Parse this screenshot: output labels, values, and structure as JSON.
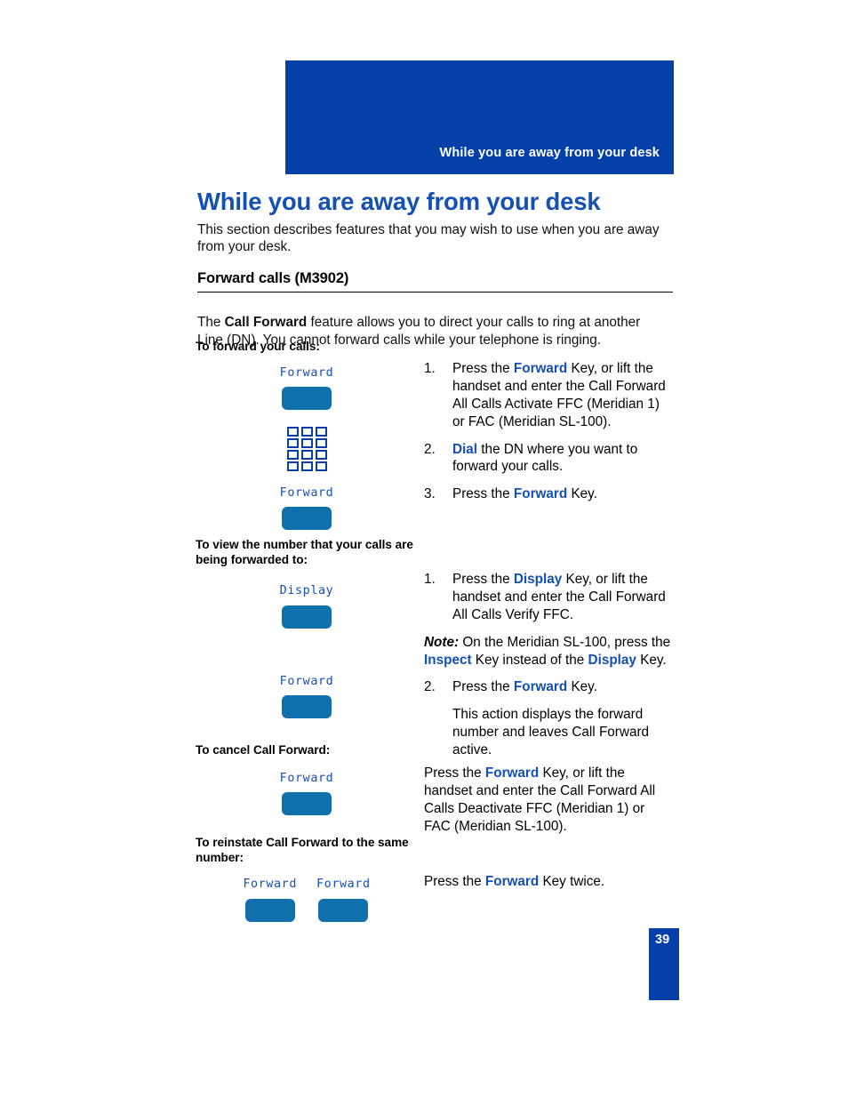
{
  "header": {
    "running_title": "While you are away from your desk",
    "band_color": "#0440a8"
  },
  "page": {
    "title": "While you are away from your desk",
    "title_color": "#1550b5",
    "intro": "This section describes features that you may wish to use when you are away from your desk.",
    "section_title": "Forward calls (M3902)",
    "lead_part1": "The ",
    "lead_bold": "Call Forward",
    "lead_part2": " feature allows you to direct your calls to ring at another Line (DN). You cannot forward calls while your telephone is ringing.",
    "page_number": "39"
  },
  "colors": {
    "accent_blue": "#1550b5",
    "header_blue": "#0440a8",
    "softkey_blue": "#1070ae"
  },
  "icons": {
    "keypad": "dialpad-icon",
    "softkey": "soft-key-icon"
  },
  "sections": [
    {
      "id": "forward-your-calls",
      "heading": "To forward your calls:",
      "keys": [
        {
          "label": "Forward",
          "type": "softkey"
        },
        {
          "label": "",
          "type": "keypad"
        },
        {
          "label": "Forward",
          "type": "softkey"
        }
      ],
      "steps": [
        {
          "num": "1.",
          "runs": [
            {
              "t": "Press the ",
              "b": false
            },
            {
              "t": "Forward",
              "b": true
            },
            {
              "t": " Key, or lift the handset and enter the Call Forward All Calls Activate FFC (Meridian 1) or FAC (Meridian SL-100).",
              "b": false
            }
          ]
        },
        {
          "num": "2.",
          "runs": [
            {
              "t": "Dial",
              "b": true
            },
            {
              "t": " the DN where you want to forward your calls.",
              "b": false
            }
          ]
        },
        {
          "num": "3.",
          "runs": [
            {
              "t": "Press the ",
              "b": false
            },
            {
              "t": "Forward",
              "b": true
            },
            {
              "t": " Key.",
              "b": false
            }
          ]
        }
      ]
    },
    {
      "id": "view-forward-number",
      "heading": "To view the number that your calls are being forwarded to:",
      "keys": [
        {
          "label": "Display",
          "type": "softkey"
        },
        {
          "label": "Forward",
          "type": "softkey"
        }
      ],
      "steps": [
        {
          "num": "1.",
          "runs": [
            {
              "t": "Press the ",
              "b": false
            },
            {
              "t": "Display",
              "b": true
            },
            {
              "t": " Key, or lift the handset and enter the Call Forward All Calls Verify FFC.",
              "b": false
            }
          ]
        },
        {
          "num": "note",
          "runs": [
            {
              "t": "Note:",
              "b": false,
              "i": true
            },
            {
              "t": " On the Meridian SL-100, press the ",
              "b": false
            },
            {
              "t": "Inspect",
              "b": true
            },
            {
              "t": " Key instead of the ",
              "b": false
            },
            {
              "t": "Display",
              "b": true
            },
            {
              "t": " Key.",
              "b": false
            }
          ]
        },
        {
          "num": "2.",
          "runs": [
            {
              "t": "Press the ",
              "b": false
            },
            {
              "t": "Forward",
              "b": true
            },
            {
              "t": " Key.",
              "b": false
            }
          ]
        },
        {
          "num": "",
          "runs": [
            {
              "t": "This action displays the forward number and leaves Call Forward active.",
              "b": false
            }
          ]
        }
      ]
    },
    {
      "id": "cancel-call-forward",
      "heading": "To cancel Call Forward:",
      "keys": [
        {
          "label": "Forward",
          "type": "softkey"
        }
      ],
      "steps": [
        {
          "num": "",
          "runs": [
            {
              "t": "Press the ",
              "b": false
            },
            {
              "t": "Forward",
              "b": true
            },
            {
              "t": " Key, or lift the handset and enter the Call Forward All Calls Deactivate FFC (Meridian 1) or FAC (Meridian SL-100).",
              "b": false
            }
          ]
        }
      ]
    },
    {
      "id": "reinstate-call-forward",
      "heading": "To reinstate Call Forward to the same number:",
      "keys": [
        {
          "label": "Forward",
          "type": "softkey"
        },
        {
          "label": "Forward",
          "type": "softkey"
        }
      ],
      "steps": [
        {
          "num": "",
          "runs": [
            {
              "t": "Press the ",
              "b": false
            },
            {
              "t": "Forward",
              "b": true
            },
            {
              "t": " Key twice.",
              "b": false
            }
          ]
        }
      ]
    }
  ]
}
